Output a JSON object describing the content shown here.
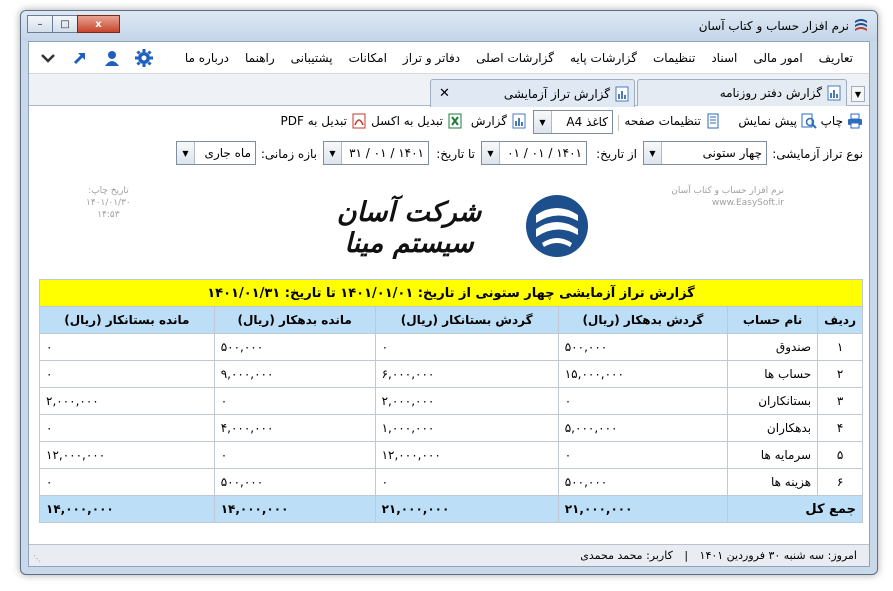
{
  "window": {
    "title": "نرم افزار حساب و کتاب آسان",
    "close_glyph": "x",
    "maximize_glyph": "□",
    "minimize_glyph": "–"
  },
  "menu": {
    "items": [
      "تعاریف",
      "امور مالی",
      "اسناد",
      "تنظیمات",
      "گزارشات پایه",
      "گزارشات اصلی",
      "دفاتر و تراز",
      "امکانات",
      "پشتیبانی",
      "راهنما",
      "درباره ما"
    ],
    "icons": [
      "gear-icon",
      "user-icon",
      "arrow-up-right-icon",
      "chevron-down-icon"
    ]
  },
  "tabs": [
    {
      "label": "گزارش دفتر روزنامه",
      "active": false
    },
    {
      "label": "گزارش تراز آزمایشی",
      "active": true
    }
  ],
  "toolbar": {
    "print": "چاپ",
    "preview": "پیش نمایش",
    "page_setup": "تنظیمات صفحه",
    "paper_size": "کاغذ A4",
    "report": "گزارش",
    "to_excel": "تبدیل به اکسل",
    "to_pdf": "تبدیل به PDF"
  },
  "filters": {
    "balance_type_label": "نوع تراز آزمایشی:",
    "balance_type_value": "چهار ستونی",
    "from_label": "از تاریخ:",
    "from_value": "۱۴۰۱ / ۰۱ / ۰۱",
    "to_label": "تا تاریخ:",
    "to_value": "۱۴۰۱ / ۰۱ / ۳۱",
    "period_label": "بازه زمانی:",
    "period_value": "ماه جاری"
  },
  "report": {
    "print_date_label": "تاریخ چاپ:",
    "print_date": "۱۴۰۱/۰۱/۳۰",
    "print_time": "۱۴:۵۳",
    "software_name": "نرم افزار حساب و کتاب آسان",
    "website": "www.EasySoft.ir",
    "company_name": "شرکت آسان سیستم مینا",
    "title": "گزارش تراز آزمایشی چهار ستونی از تاریخ: ۱۴۰۱/۰۱/۰۱ تا تاریخ: ۱۴۰۱/۰۱/۳۱",
    "columns": [
      "ردیف",
      "نام حساب",
      "گردش بدهکار (ریال)",
      "گردش بستانکار (ریال)",
      "مانده بدهکار (ریال)",
      "مانده بستانکار (ریال)"
    ],
    "rows": [
      [
        "۱",
        "صندوق",
        "۵۰۰,۰۰۰",
        "۰",
        "۵۰۰,۰۰۰",
        "۰"
      ],
      [
        "۲",
        "حساب ها",
        "۱۵,۰۰۰,۰۰۰",
        "۶,۰۰۰,۰۰۰",
        "۹,۰۰۰,۰۰۰",
        "۰"
      ],
      [
        "۳",
        "بستانکاران",
        "۰",
        "۲,۰۰۰,۰۰۰",
        "۰",
        "۲,۰۰۰,۰۰۰"
      ],
      [
        "۴",
        "بدهکاران",
        "۵,۰۰۰,۰۰۰",
        "۱,۰۰۰,۰۰۰",
        "۴,۰۰۰,۰۰۰",
        "۰"
      ],
      [
        "۵",
        "سرمایه ها",
        "۰",
        "۱۲,۰۰۰,۰۰۰",
        "۰",
        "۱۲,۰۰۰,۰۰۰"
      ],
      [
        "۶",
        "هزینه ها",
        "۵۰۰,۰۰۰",
        "۰",
        "۵۰۰,۰۰۰",
        "۰"
      ]
    ],
    "total": [
      "جمع کل",
      "۲۱,۰۰۰,۰۰۰",
      "۲۱,۰۰۰,۰۰۰",
      "۱۴,۰۰۰,۰۰۰",
      "۱۴,۰۰۰,۰۰۰"
    ]
  },
  "status": {
    "today": "امروز: سه شنبه ۳۰ فروردین ۱۴۰۱",
    "separator": "|",
    "user": "کاربر: محمد محمدی"
  },
  "colors": {
    "title_row": "#ffff00",
    "header_row": "#bcdff7",
    "logo_blue": "#1c4f8c"
  }
}
